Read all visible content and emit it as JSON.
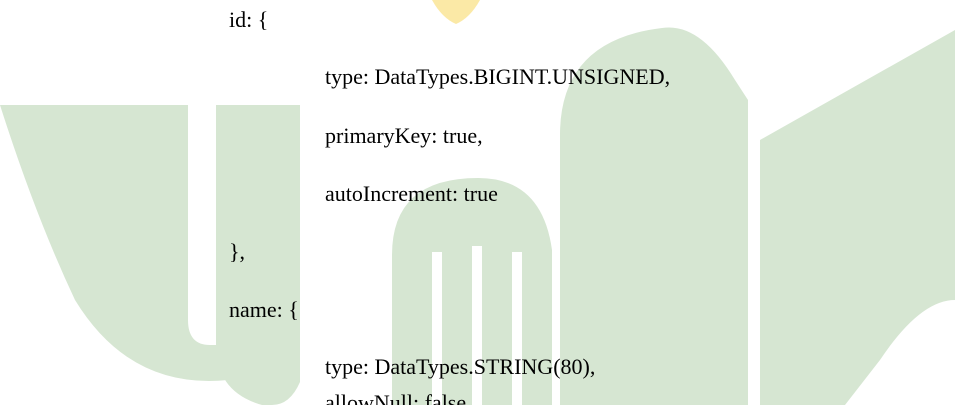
{
  "colors": {
    "page_background": "#ffffff",
    "text": "#000000",
    "watermark_green": "#d6e6d2",
    "watermark_yellow": "#fbe9a6"
  },
  "watermark": {
    "icon": "university-logo-watermark"
  },
  "code_lines": [
    {
      "text": "id: {"
    },
    {
      "text": "type: DataTypes.BIGINT.UNSIGNED,"
    },
    {
      "text": "primaryKey: true,"
    },
    {
      "text": "autoIncrement: true"
    },
    {
      "text": "},"
    },
    {
      "text": "name: {"
    },
    {
      "text": "type: DataTypes.STRING(80),"
    },
    {
      "text": "allowNull: false,"
    }
  ]
}
